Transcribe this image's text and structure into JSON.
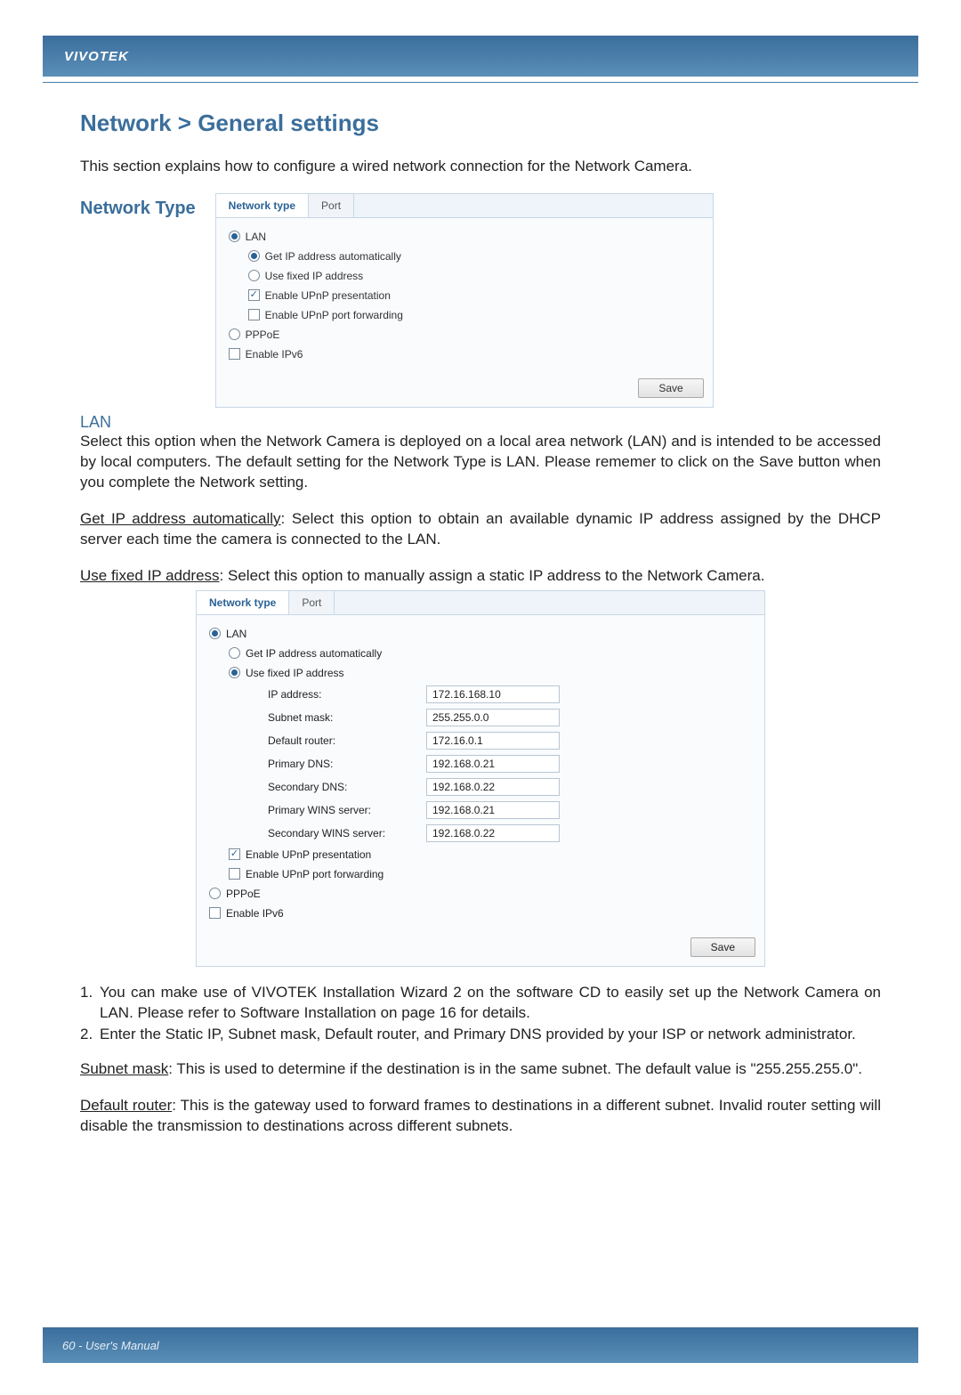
{
  "brand": "VIVOTEK",
  "title": "Network > General settings",
  "intro": "This section explains how to configure a wired network connection for the Network Camera.",
  "network_type_label": "Network Type",
  "panel1": {
    "tabs": {
      "a": "Network type",
      "b": "Port"
    },
    "lan": "LAN",
    "get_auto": "Get IP address automatically",
    "use_fixed": "Use fixed IP address",
    "upnp_pres": "Enable UPnP presentation",
    "upnp_fwd": "Enable UPnP port forwarding",
    "pppoe": "PPPoE",
    "ipv6": "Enable IPv6",
    "save": "Save"
  },
  "lan_head": "LAN",
  "lan_para": "Select this option when the Network Camera is deployed on a local area network (LAN) and is intended to be accessed by local computers. The default setting for the Network Type is LAN. Please rememer to click on the Save button when you complete the Network setting.",
  "get_auto_u": "Get IP address automatically",
  "get_auto_rest": ": Select this option to obtain an available dynamic IP address assigned by the DHCP server each time the camera is connected to the LAN.",
  "use_fixed_u": "Use fixed IP address",
  "use_fixed_rest": ": Select this option to manually assign a static IP address to the Network Camera.",
  "panel2": {
    "tabs": {
      "a": "Network type",
      "b": "Port"
    },
    "lan": "LAN",
    "get_auto": "Get IP address automatically",
    "use_fixed": "Use fixed IP address",
    "fields": {
      "ip_label": "IP address:",
      "ip_val": "172.16.168.10",
      "subnet_label": "Subnet mask:",
      "subnet_val": "255.255.0.0",
      "router_label": "Default router:",
      "router_val": "172.16.0.1",
      "pdns_label": "Primary DNS:",
      "pdns_val": "192.168.0.21",
      "sdns_label": "Secondary DNS:",
      "sdns_val": "192.168.0.22",
      "pwins_label": "Primary WINS server:",
      "pwins_val": "192.168.0.21",
      "swins_label": "Secondary WINS server:",
      "swins_val": "192.168.0.22"
    },
    "upnp_pres": "Enable UPnP presentation",
    "upnp_fwd": "Enable UPnP port forwarding",
    "pppoe": "PPPoE",
    "ipv6": "Enable IPv6",
    "save": "Save"
  },
  "list1_n": "1.",
  "list1_t": "You can make use of VIVOTEK Installation Wizard 2 on the software CD to easily set up the Network Camera on LAN. Please refer to Software Installation on page 16 for details.",
  "list2_n": "2.",
  "list2_t": "Enter the Static IP, Subnet mask, Default router, and Primary DNS provided by your ISP or network administrator.",
  "subnet_u": "Subnet mask",
  "subnet_rest": ": This is used to determine if the destination is in the same subnet. The default value is \"255.255.255.0\".",
  "router_u": "Default router",
  "router_rest": ": This is the gateway used to forward frames to destinations in a different subnet. Invalid router setting will disable the transmission to destinations across different subnets.",
  "footer": "60 - User's Manual"
}
